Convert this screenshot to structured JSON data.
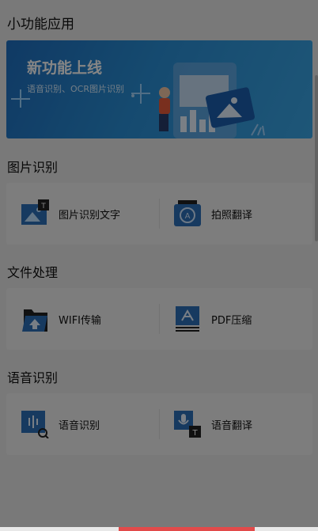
{
  "header": {
    "title": "小功能应用"
  },
  "banner": {
    "title": "新功能上线",
    "subtitle": "语音识别、OCR图片识别"
  },
  "sections": [
    {
      "title": "图片识别",
      "items": [
        {
          "label": "图片识别文字",
          "icon": "image-text-icon"
        },
        {
          "label": "拍照翻译",
          "icon": "camera-translate-icon"
        }
      ]
    },
    {
      "title": "文件处理",
      "items": [
        {
          "label": "WIFI传输",
          "icon": "wifi-transfer-icon"
        },
        {
          "label": "PDF压缩",
          "icon": "pdf-compress-icon"
        }
      ]
    },
    {
      "title": "语音识别",
      "items": [
        {
          "label": "语音识别",
          "icon": "voice-recognition-icon"
        },
        {
          "label": "语音翻译",
          "icon": "voice-translate-icon"
        }
      ]
    }
  ],
  "colors": {
    "accent": "#1f6fc0",
    "overlay": "rgba(0,0,0,0.48)",
    "bottom_indicator": "#e24a4a"
  }
}
